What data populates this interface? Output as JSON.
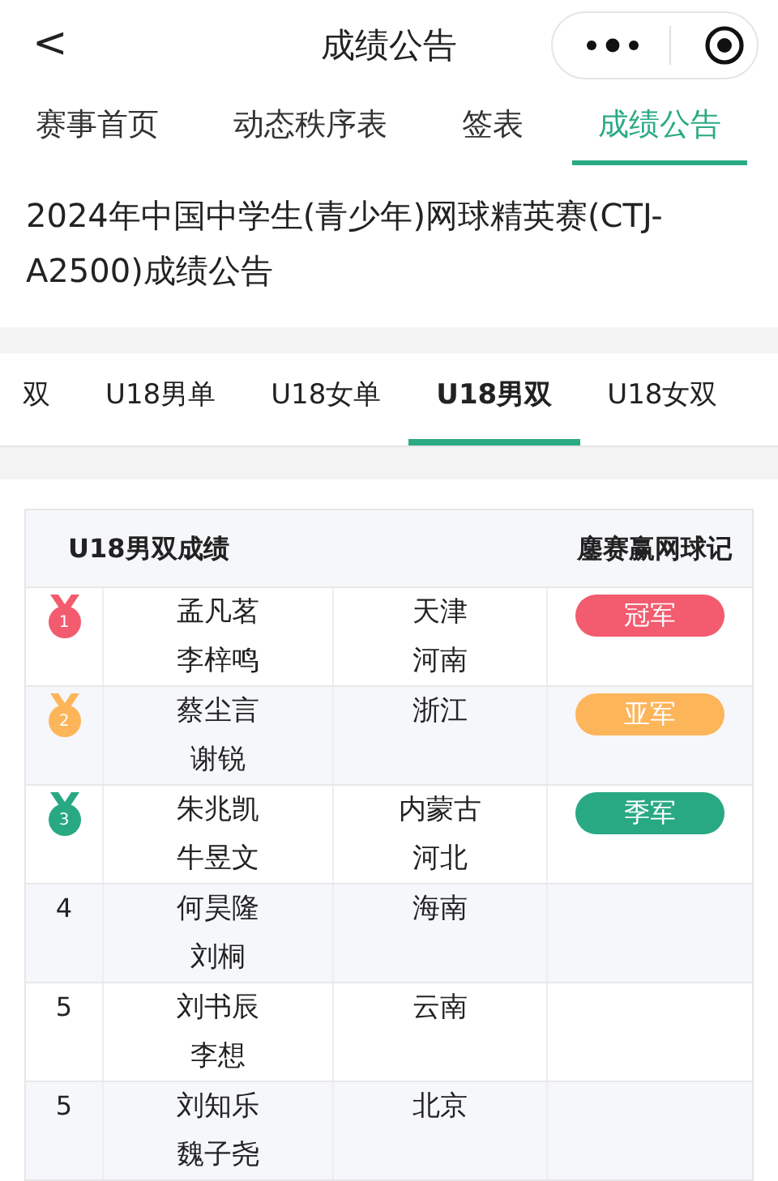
{
  "nav": {
    "back": "<",
    "title": "成绩公告"
  },
  "tabs": [
    {
      "label": "赛事首页",
      "selected": false
    },
    {
      "label": "动态秩序表",
      "selected": false
    },
    {
      "label": "签表",
      "selected": false
    },
    {
      "label": "成绩公告",
      "selected": true
    }
  ],
  "headline": "2024年中国中学生(青少年)网球精英赛(CTJ-A2500)成绩公告",
  "event_tabs": [
    {
      "label": "双",
      "selected": false
    },
    {
      "label": "U18男单",
      "selected": false
    },
    {
      "label": "U18女单",
      "selected": false
    },
    {
      "label": "U18男双",
      "selected": true
    },
    {
      "label": "U18女双",
      "selected": false
    }
  ],
  "results": {
    "title": "U18男双成绩",
    "brand": "鏖赛赢网球记",
    "rows": [
      {
        "kind": "medal",
        "rank": "1",
        "color": "#f35b6f",
        "players": [
          "孟凡茗",
          "李梓鸣"
        ],
        "provinces": [
          "天津",
          "河南"
        ],
        "award": "冠军"
      },
      {
        "kind": "medal",
        "rank": "2",
        "color": "#fdb55a",
        "players": [
          "蔡尘言",
          "谢锐"
        ],
        "provinces": [
          "浙江"
        ],
        "award": "亚军"
      },
      {
        "kind": "medal",
        "rank": "3",
        "color": "#28a983",
        "players": [
          "朱兆凯",
          "牛昱文"
        ],
        "provinces": [
          "内蒙古",
          "河北"
        ],
        "award": "季军"
      },
      {
        "kind": "number",
        "rank": "4",
        "players": [
          "何昊隆",
          "刘桐"
        ],
        "provinces": [
          "海南"
        ]
      },
      {
        "kind": "number",
        "rank": "5",
        "players": [
          "刘书辰",
          "李想"
        ],
        "provinces": [
          "云南"
        ]
      },
      {
        "kind": "number",
        "rank": "5",
        "players": [
          "刘知乐",
          "魏子尧"
        ],
        "provinces": [
          "北京"
        ]
      }
    ]
  }
}
